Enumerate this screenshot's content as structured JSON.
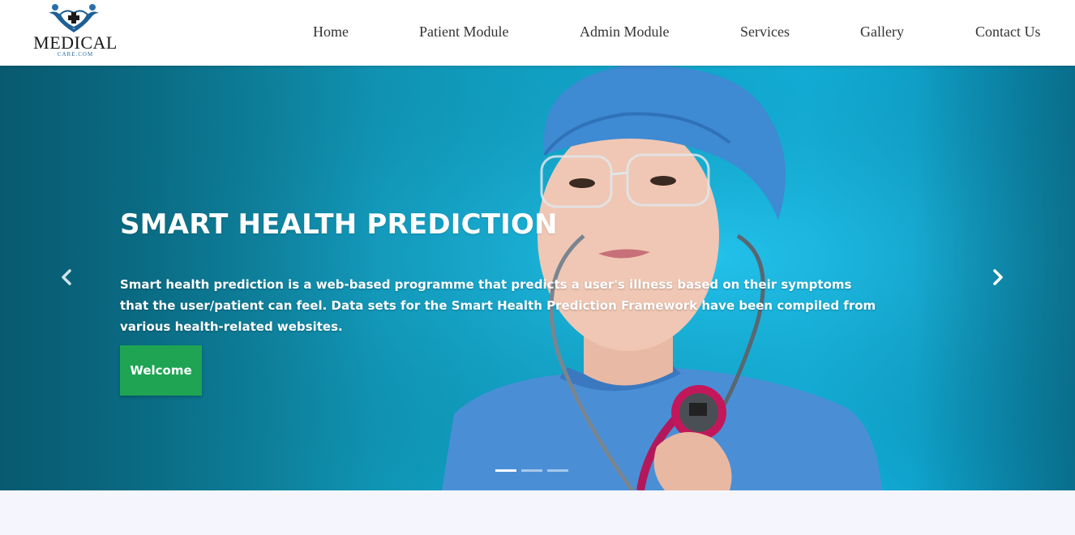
{
  "brand": {
    "name": "MEDICAL",
    "tagline": "CARE.COM",
    "icon": "medical-cross-people-icon",
    "color": "#2a6ea8"
  },
  "nav": {
    "items": [
      {
        "label": "Home"
      },
      {
        "label": "Patient Module"
      },
      {
        "label": "Admin Module"
      },
      {
        "label": "Services"
      },
      {
        "label": "Gallery"
      },
      {
        "label": "Contact Us"
      }
    ]
  },
  "hero": {
    "title": "SMART HEALTH PREDICTION",
    "description": "Smart health prediction is a web-based programme that predicts a user's illness based on their symptoms that the user/patient can feel. Data sets for the Smart Health Prediction Framework have been compiled from various health-related websites.",
    "button_label": "Welcome",
    "button_color": "#1ea453",
    "prev_icon": "chevron-left-icon",
    "next_icon": "chevron-right-icon",
    "slide_count": 3,
    "active_slide": 1
  }
}
